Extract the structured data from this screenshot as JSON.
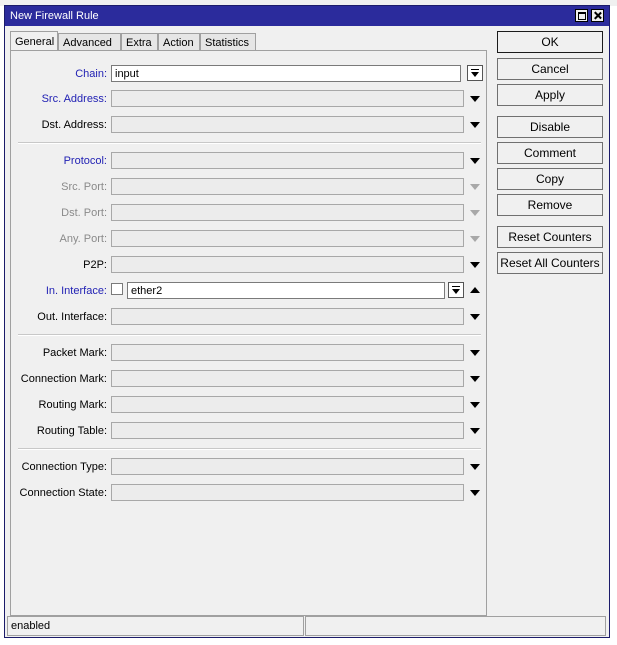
{
  "window": {
    "title": "New Firewall Rule"
  },
  "tabs": [
    "General",
    "Advanced",
    "Extra",
    "Action",
    "Statistics"
  ],
  "fields": {
    "chain": {
      "label": "Chain:",
      "value": "input"
    },
    "src_address": {
      "label": "Src. Address:",
      "value": ""
    },
    "dst_address": {
      "label": "Dst. Address:",
      "value": ""
    },
    "protocol": {
      "label": "Protocol:",
      "value": ""
    },
    "src_port": {
      "label": "Src. Port:",
      "value": ""
    },
    "dst_port": {
      "label": "Dst. Port:",
      "value": ""
    },
    "any_port": {
      "label": "Any. Port:",
      "value": ""
    },
    "p2p": {
      "label": "P2P:",
      "value": ""
    },
    "in_interface": {
      "label": "In. Interface:",
      "value": "ether2"
    },
    "out_interface": {
      "label": "Out. Interface:",
      "value": ""
    },
    "packet_mark": {
      "label": "Packet Mark:",
      "value": ""
    },
    "connection_mark": {
      "label": "Connection Mark:",
      "value": ""
    },
    "routing_mark": {
      "label": "Routing Mark:",
      "value": ""
    },
    "routing_table": {
      "label": "Routing Table:",
      "value": ""
    },
    "connection_type": {
      "label": "Connection Type:",
      "value": ""
    },
    "connection_state": {
      "label": "Connection State:",
      "value": ""
    }
  },
  "buttons": {
    "ok": "OK",
    "cancel": "Cancel",
    "apply": "Apply",
    "disable": "Disable",
    "comment": "Comment",
    "copy": "Copy",
    "remove": "Remove",
    "reset_counters": "Reset Counters",
    "reset_all_counters": "Reset All Counters"
  },
  "status": {
    "left": "enabled",
    "right": ""
  },
  "colors": {
    "titlebar": "#2b2b9c",
    "label_link": "#2222b4",
    "label_disabled": "#8a8a8a"
  }
}
